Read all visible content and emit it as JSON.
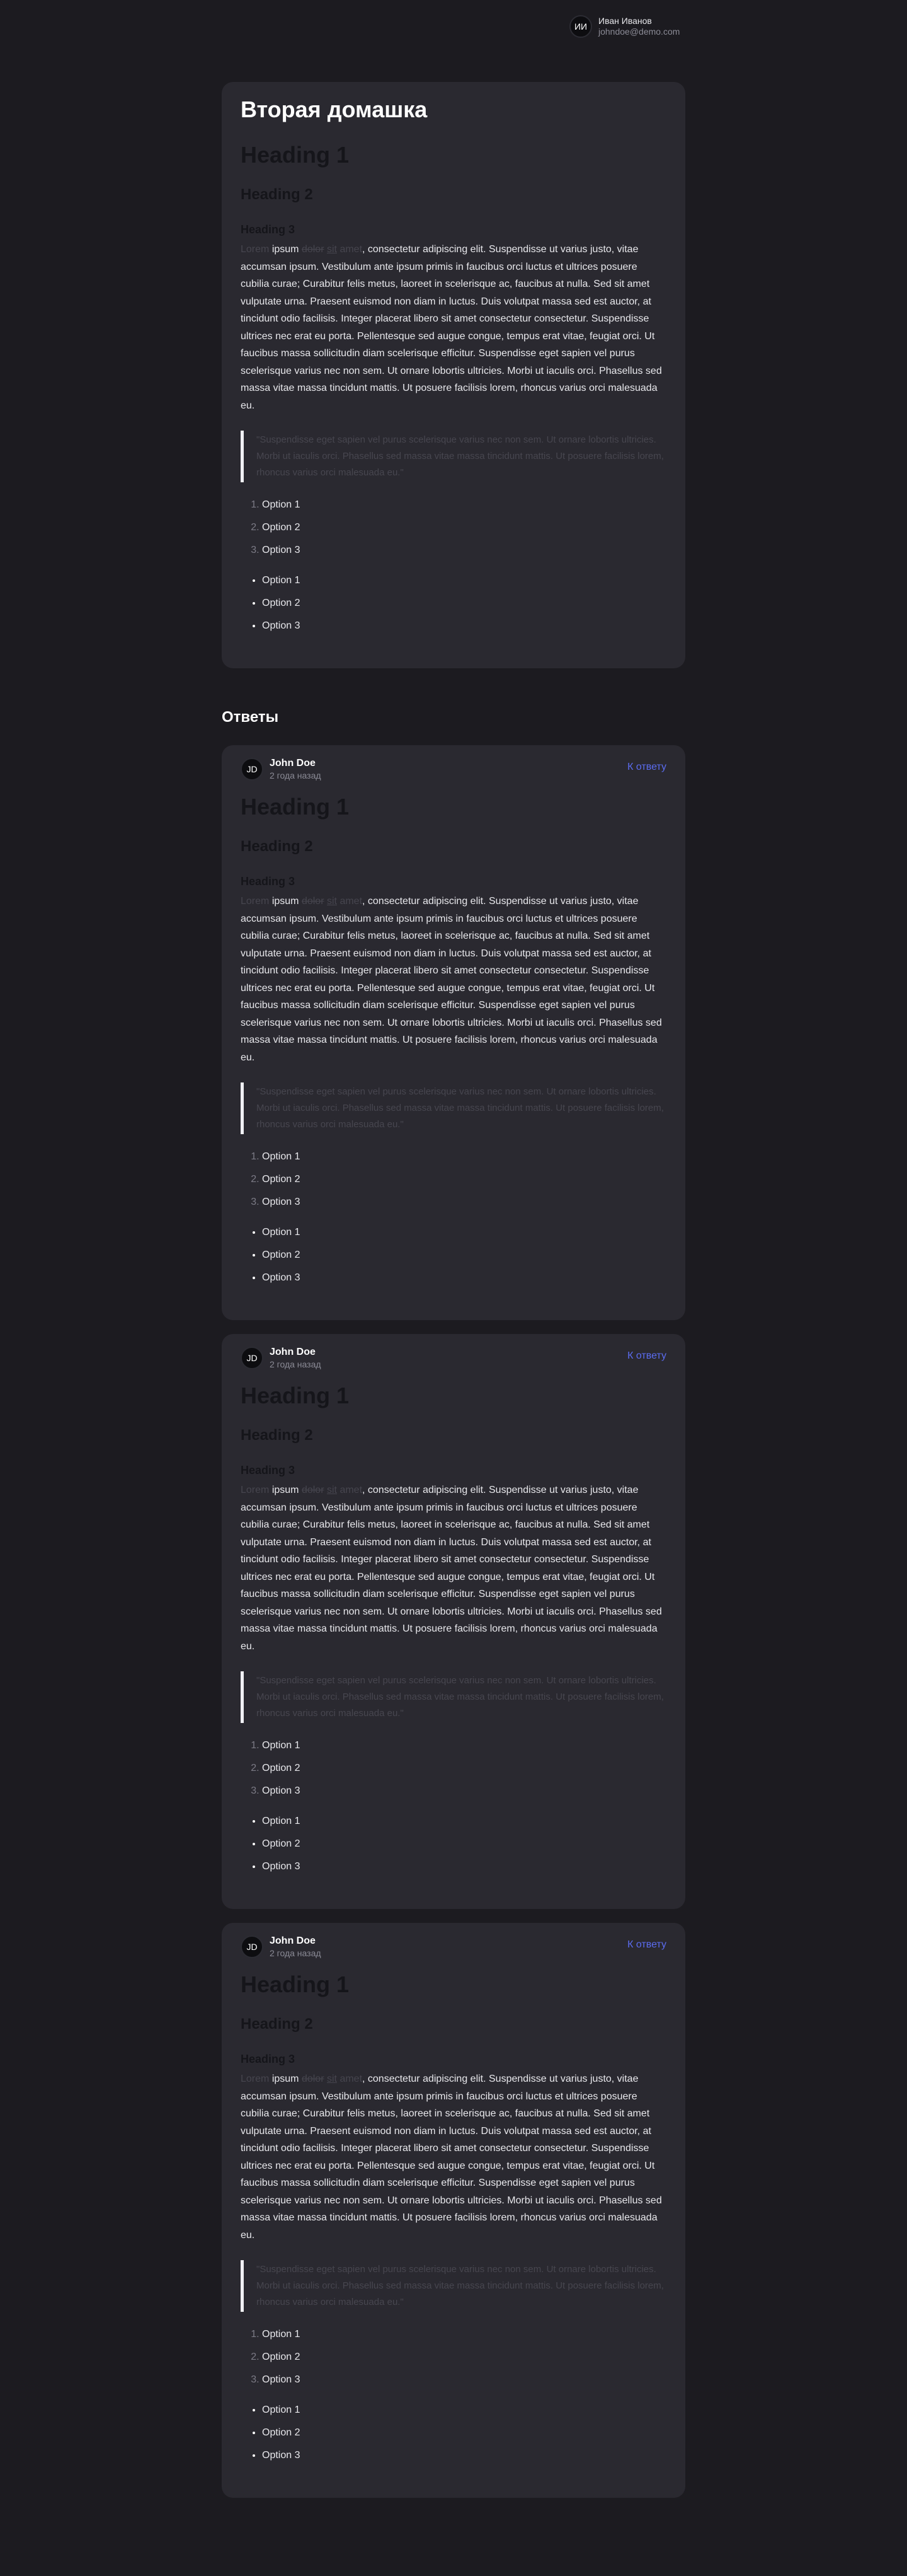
{
  "user": {
    "initials": "ИИ",
    "name": "Иван Иванов",
    "email": "johndoe@demo.com"
  },
  "homework": {
    "title": "Вторая домашка"
  },
  "answers_title": "Ответы",
  "reply_label": "К ответу",
  "markdown": {
    "h1": "Heading 1",
    "h2": "Heading 2",
    "h3": "Heading 3",
    "p_lorem": "Lorem",
    "p_ipsum": "ipsum",
    "p_dolor": "dolor",
    "p_sit": "sit",
    "p_amet": "amet",
    "p_rest": ", consectetur adipiscing elit. Suspendisse ut varius justo, vitae accumsan ipsum. Vestibulum ante ipsum primis in faucibus orci luctus et ultrices posuere cubilia curae; Curabitur felis metus, laoreet in scelerisque ac, faucibus at nulla. Sed sit amet vulputate urna. Praesent euismod non diam in luctus. Duis volutpat massa sed est auctor, at tincidunt odio facilisis. Integer placerat libero sit amet consectetur consectetur. Suspendisse ultrices nec erat eu porta. Pellentesque sed augue congue, tempus erat vitae, feugiat orci. Ut faucibus massa sollicitudin diam scelerisque efficitur. Suspendisse eget sapien vel purus scelerisque varius nec non sem. Ut ornare lobortis ultricies. Morbi ut iaculis orci. Phasellus sed massa vitae massa tincidunt mattis. Ut posuere facilisis lorem, rhoncus varius orci malesuada eu.",
    "quote": "\"Suspendisse eget sapien vel purus scelerisque varius nec non sem. Ut ornare lobortis ultricies. Morbi ut iaculis orci. Phasellus sed massa vitae massa tincidunt mattis. Ut posuere facilisis lorem, rhoncus varius orci malesuada eu.\"",
    "ordered": [
      "Option 1",
      "Option 2",
      "Option 3"
    ],
    "unordered": [
      "Option 1",
      "Option 2",
      "Option 3"
    ]
  },
  "answers": [
    {
      "initials": "JD",
      "author": "John Doe",
      "time": "2 года назад"
    },
    {
      "initials": "JD",
      "author": "John Doe",
      "time": "2 года назад"
    },
    {
      "initials": "JD",
      "author": "John Doe",
      "time": "2 года назад"
    }
  ]
}
